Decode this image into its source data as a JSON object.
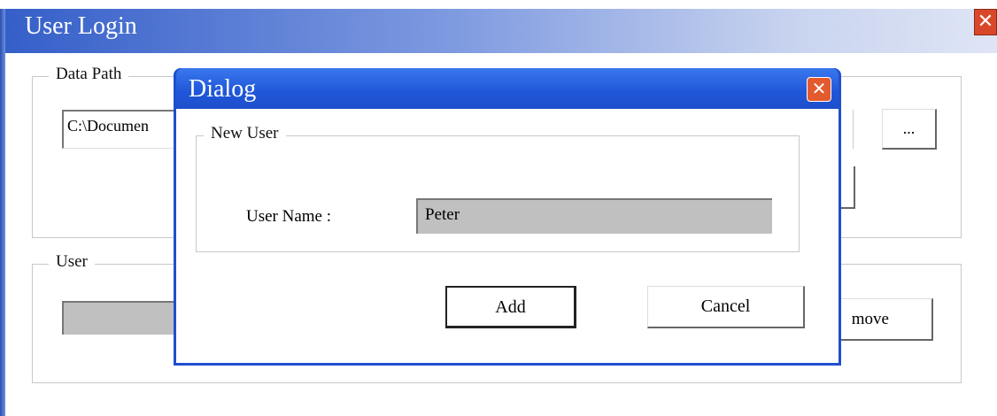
{
  "main_window": {
    "title": "User Login",
    "close_icon": "close-icon",
    "data_path_group": {
      "legend": "Data Path",
      "path_value": "C:\\Documen",
      "browse_label": "..."
    },
    "user_group": {
      "legend": "User",
      "remove_label": "move"
    }
  },
  "dialog": {
    "title": "Dialog",
    "close_icon": "close-icon",
    "new_user_group": {
      "legend": "New User",
      "user_name_label": "User Name :",
      "user_name_value": "Peter"
    },
    "add_label": "Add",
    "cancel_label": "Cancel"
  },
  "colors": {
    "titlebar_blue": "#1f56d8",
    "close_red": "#e35a2e",
    "disabled_field": "#c0c0c0"
  }
}
